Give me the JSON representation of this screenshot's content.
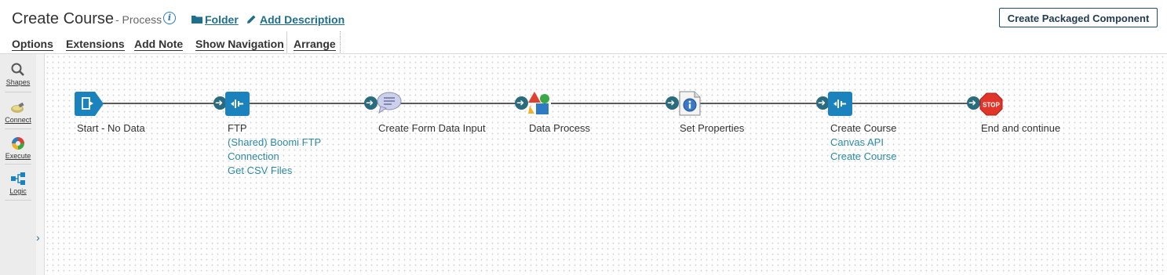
{
  "header": {
    "title": "Create Course",
    "subtitle": "- Process",
    "folder_link": "Folder",
    "add_description_link": "Add Description",
    "packaged_button": "Create Packaged Component",
    "info_icon": "i"
  },
  "menu": {
    "options": "Options",
    "extensions": "Extensions",
    "add_note": "Add Note",
    "show_navigation": "Show Navigation",
    "arrange": "Arrange"
  },
  "leftbar": {
    "shapes": "Shapes",
    "connect": "Connect",
    "execute": "Execute",
    "logic": "Logic"
  },
  "shapes": [
    {
      "label": "Start - No Data",
      "icon": "start-icon"
    },
    {
      "label": "FTP",
      "sub1": "(Shared) Boomi FTP",
      "sub2": "Connection",
      "sub3": "Get CSV Files",
      "icon": "connector-icon"
    },
    {
      "label": "Create Form Data Input",
      "icon": "message-icon"
    },
    {
      "label": "Data Process",
      "icon": "data-process-icon"
    },
    {
      "label": "Set Properties",
      "icon": "set-properties-icon"
    },
    {
      "label": "Create Course",
      "sub1": "Canvas API",
      "sub2": "Create Course",
      "icon": "connector-icon"
    },
    {
      "label": "End and continue",
      "icon": "stop-icon"
    }
  ],
  "colors": {
    "accent": "#1f6e8c",
    "connector_blue": "#1a83bd",
    "stop_red": "#e2352a"
  }
}
